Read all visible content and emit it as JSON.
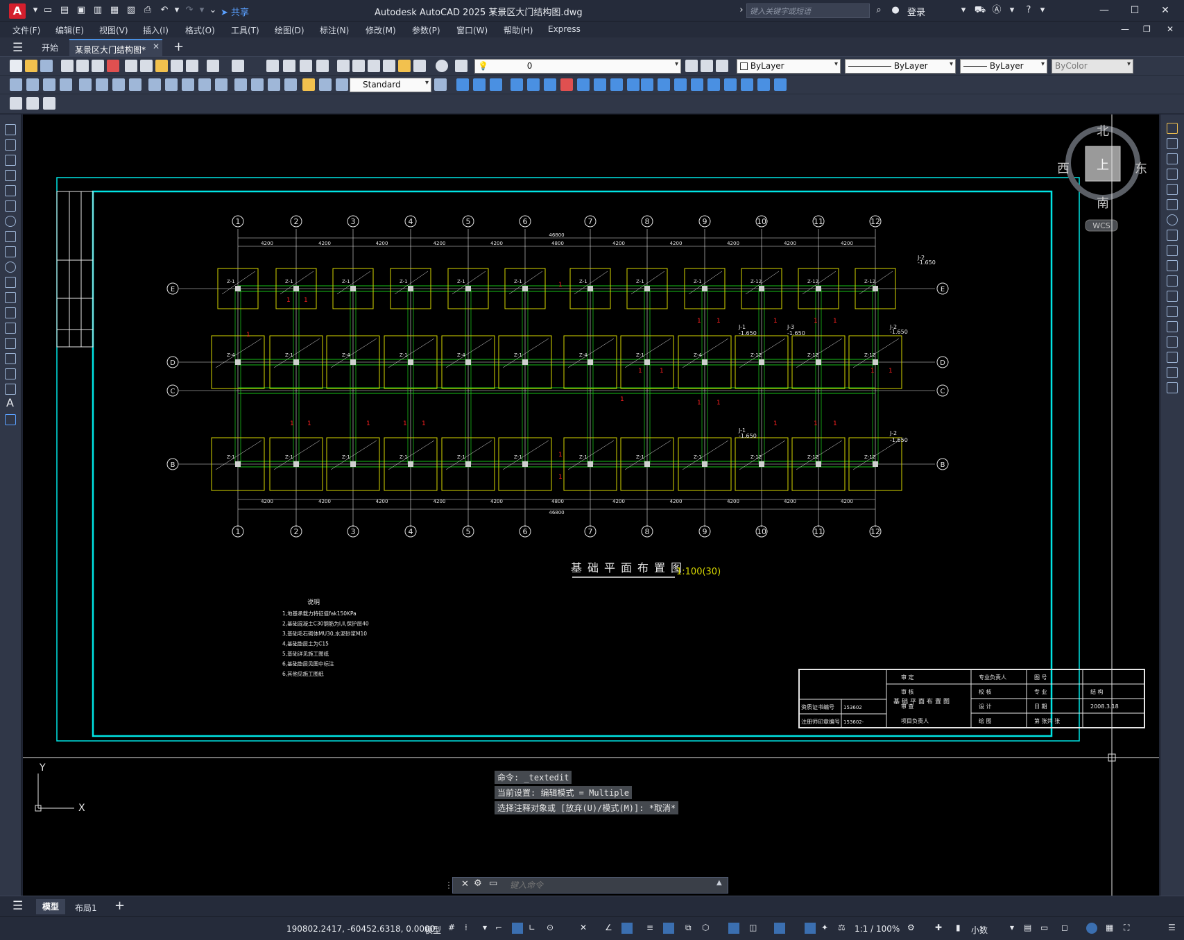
{
  "app": {
    "title": "Autodesk AutoCAD 2025    某景区大门结构图.dwg",
    "logo_letter": "A",
    "share_label": "共享",
    "search_placeholder": "键入关键字或短语",
    "login_label": "登录"
  },
  "menu": [
    "文件(F)",
    "编辑(E)",
    "视图(V)",
    "插入(I)",
    "格式(O)",
    "工具(T)",
    "绘图(D)",
    "标注(N)",
    "修改(M)",
    "参数(P)",
    "窗口(W)",
    "帮助(H)",
    "Express"
  ],
  "tabs": {
    "start": "开始",
    "active": "某景区大门结构图*"
  },
  "toolbar": {
    "layer_value": "0",
    "text_style": "Standard",
    "color_value": "ByLayer",
    "linetype_value": "ByLayer",
    "lineweight_value": "ByLayer",
    "plotstyle_value": "ByColor"
  },
  "viewcube": {
    "north": "北",
    "south": "南",
    "east": "东",
    "west": "西",
    "face": "上",
    "wcs": "WCS"
  },
  "drawing": {
    "axis_numbers": [
      "1",
      "2",
      "3",
      "4",
      "5",
      "6",
      "7",
      "8",
      "9",
      "10",
      "11",
      "12"
    ],
    "axis_letters": [
      "E",
      "D",
      "C",
      "B"
    ],
    "total_dim": "46800",
    "bay_dims": [
      "4200",
      "4200",
      "4200",
      "4200",
      "4200",
      "4800",
      "4200",
      "4200",
      "4200",
      "4200",
      "4200"
    ],
    "plan_title": "基础平面布置图",
    "scale_text": "1:100(30)",
    "notes_title": "说明",
    "notes": [
      "1,地基承载力特征值fak150KPa",
      "2,基础混凝土C30钢筋为Ⅰ,Ⅱ,保护层40",
      "3,基础毛石砌体MU30,水泥砂浆M10",
      "4,基础垫层土为C15",
      "5,基础详见施工图纸",
      "6,基础垫层见图中标注",
      "6,其他见施工图纸"
    ],
    "footing_labels": [
      "Z-1",
      "Z-4",
      "Z-12",
      "Z-14",
      "J-1",
      "J-2",
      "J-3"
    ],
    "elevation_label": "-1.650",
    "title_block": {
      "drawing_name": "基础平面布置图",
      "cert_label": "资质证书编号",
      "cert_value": "153602",
      "reg_label": "注册师印章编号",
      "reg_value": "153602-",
      "rows": [
        [
          "审 定",
          "专业负责人",
          "图 号",
          ""
        ],
        [
          "审 核",
          "校 核",
          "专 业",
          "结 构"
        ],
        [
          "审 查",
          "设 计",
          "日 期",
          "2008.3.18"
        ],
        [
          "项目负责人",
          "绘 图",
          "第 张共 张",
          ""
        ]
      ]
    }
  },
  "command": {
    "history": [
      "命令: _textedit",
      "当前设置: 编辑模式 = Multiple",
      "选择注释对象或 [放弃(U)/模式(M)]: *取消*"
    ],
    "placeholder": "键入命令"
  },
  "layout_tabs": {
    "model": "模型",
    "layout1": "布局1"
  },
  "status": {
    "coords": "190802.2417, -60452.6318, 0.0000",
    "model_label": "模型",
    "scale": "1:1 / 100%",
    "units": "小数"
  },
  "ucs": {
    "x": "X",
    "y": "Y"
  },
  "colors": {
    "canvas_bg": "#000000",
    "frame_cyan": "#00e5e5",
    "footing_yellow": "#d8d800",
    "beam_green": "#19c019",
    "dim_white": "#e6e6e6",
    "marker_red": "#ff2020"
  }
}
